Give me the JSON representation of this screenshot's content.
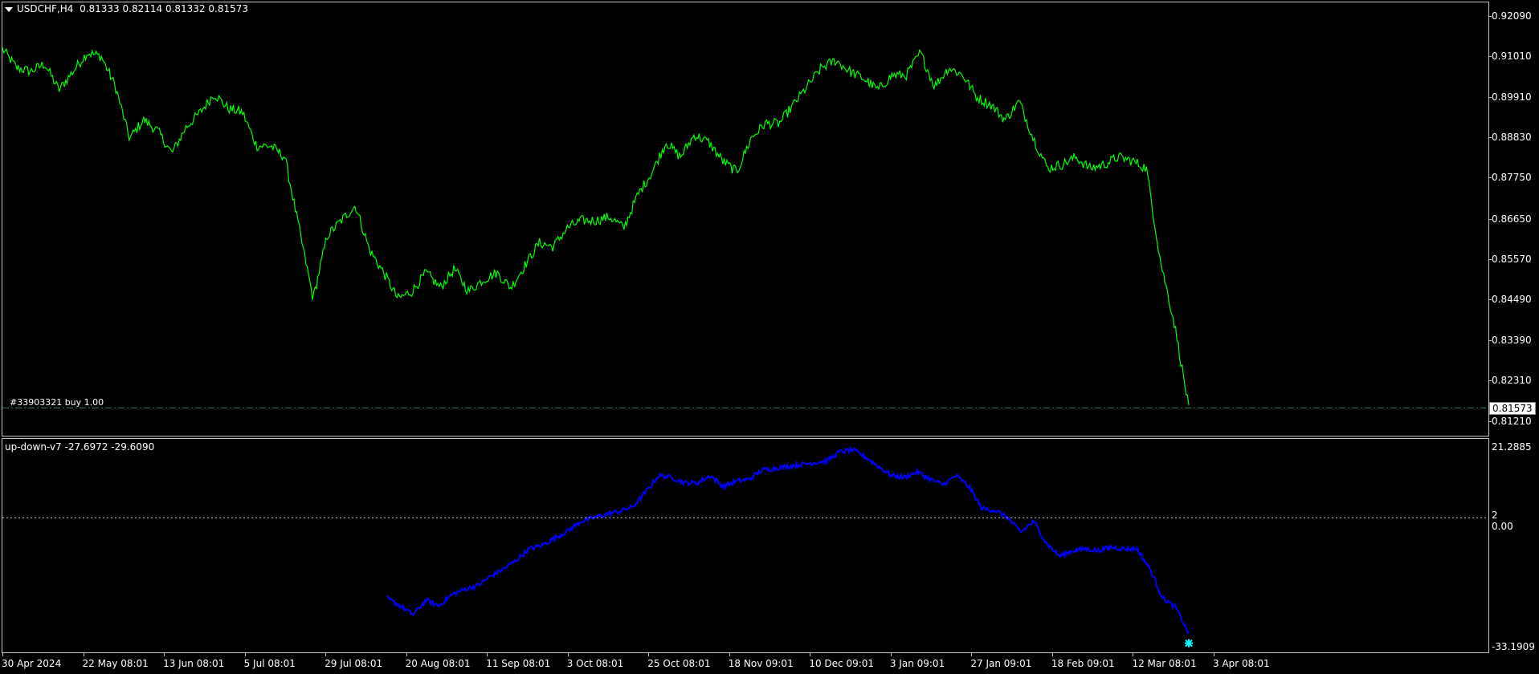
{
  "main_chart": {
    "symbol": "USDCHF,H4",
    "ohlc": "0.81333 0.82114 0.81332 0.81573",
    "order_label": "#33903321 buy 1.00",
    "current_price": "0.81573",
    "price_levels": [
      "0.92090",
      "0.91010",
      "0.89910",
      "0.88830",
      "0.87750",
      "0.86650",
      "0.85570",
      "0.84490",
      "0.83390",
      "0.82310",
      "0.81210"
    ]
  },
  "indicator": {
    "title": "up-down-v7 -27.6972 -29.6090",
    "levels": [
      "21.2885",
      "2",
      "0.00",
      "-33.1909"
    ]
  },
  "dates": [
    "30 Apr 2024",
    "22 May 08:01",
    "13 Jun 08:01",
    "5 Jul 08:01",
    "29 Jul 08:01",
    "20 Aug 08:01",
    "11 Sep 08:01",
    "3 Oct 08:01",
    "25 Oct 08:01",
    "18 Nov 09:01",
    "10 Dec 09:01",
    "3 Jan 09:01",
    "27 Jan 09:01",
    "18 Feb 09:01",
    "12 Mar 08:01",
    "3 Apr 08:01"
  ],
  "colors": {
    "price_line": "#00ff00",
    "indicator_line": "#0000ff",
    "marker": "#00ffff",
    "dashed": "#c8c8c8",
    "order_line": "#2e8b57"
  },
  "chart_data": [
    {
      "type": "line",
      "title": "USDCHF,H4",
      "ylim": [
        0.8085,
        0.9245
      ],
      "series": [
        {
          "name": "USDCHF,H4",
          "values": [
            0.912,
            0.907,
            0.906,
            0.908,
            0.901,
            0.906,
            0.911,
            0.91,
            0.902,
            0.888,
            0.893,
            0.89,
            0.884,
            0.891,
            0.895,
            0.9,
            0.896,
            0.895,
            0.886,
            0.886,
            0.883,
            0.864,
            0.845,
            0.862,
            0.866,
            0.87,
            0.858,
            0.852,
            0.845,
            0.847,
            0.852,
            0.848,
            0.853,
            0.847,
            0.85,
            0.852,
            0.848,
            0.854,
            0.86,
            0.859,
            0.864,
            0.866,
            0.866,
            0.867,
            0.864,
            0.873,
            0.879,
            0.887,
            0.883,
            0.889,
            0.887,
            0.882,
            0.879,
            0.888,
            0.892,
            0.892,
            0.897,
            0.902,
            0.907,
            0.909,
            0.906,
            0.904,
            0.901,
            0.905,
            0.905,
            0.911,
            0.902,
            0.907,
            0.905,
            0.899,
            0.897,
            0.893,
            0.898,
            0.888,
            0.88,
            0.881,
            0.883,
            0.88,
            0.881,
            0.883,
            0.882,
            0.88,
            0.855,
            0.838,
            0.8157
          ]
        }
      ]
    },
    {
      "type": "line",
      "title": "up-down-v7 -27.6972 -29.6090",
      "ylim": [
        -34.5,
        23.5
      ],
      "series": [
        {
          "name": "up-down-v7",
          "values": [
            -20.0,
            -22.0,
            -24.5,
            -20.5,
            -22.0,
            -19.0,
            -17.5,
            -16.5,
            -14.0,
            -12.0,
            -9.5,
            -6.5,
            -5.5,
            -3.5,
            -1.5,
            1.0,
            2.0,
            3.0,
            3.8,
            5.0,
            9.0,
            13.5,
            13.0,
            11.5,
            11.5,
            13.5,
            10.5,
            12.0,
            12.5,
            15.0,
            15.5,
            16.0,
            16.5,
            17.0,
            17.5,
            20.0,
            20.5,
            18.5,
            16.0,
            13.5,
            13.0,
            14.5,
            12.5,
            11.0,
            13.5,
            10.5,
            4.5,
            4.0,
            2.0,
            -2.0,
            1.0,
            -5.0,
            -8.5,
            -7.0,
            -6.5,
            -7.0,
            -6.0,
            -6.5,
            -6.5,
            -12.0,
            -20.0,
            -22.5,
            -29.6
          ]
        }
      ]
    }
  ]
}
